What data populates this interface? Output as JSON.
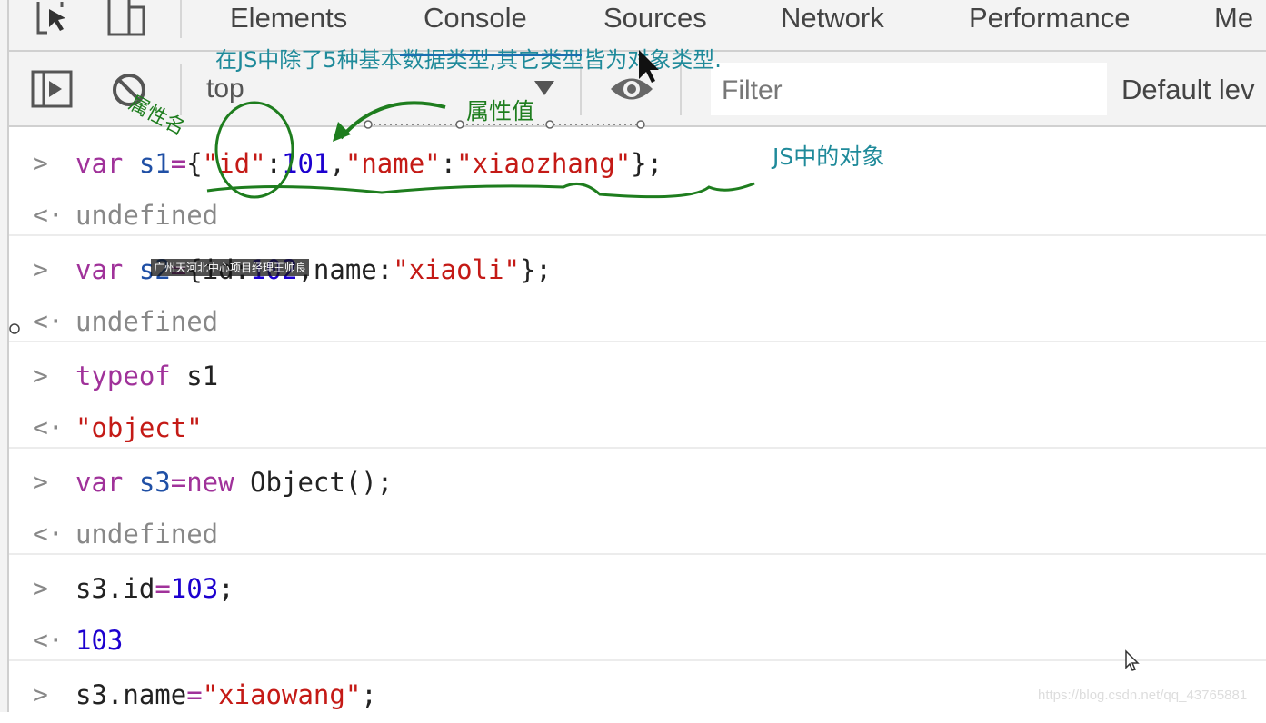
{
  "tabs": [
    "Elements",
    "Console",
    "Sources",
    "Network",
    "Performance",
    "Me"
  ],
  "toolbar": {
    "context": "top",
    "filter_placeholder": "Filter",
    "levels": "Default lev"
  },
  "console": [
    {
      "type": "input",
      "parts": [
        [
          "kw",
          "var "
        ],
        [
          "vr",
          "s1"
        ],
        [
          "kw",
          "="
        ],
        [
          "",
          "{"
        ],
        [
          "st",
          "\"id\""
        ],
        [
          "",
          ":"
        ],
        [
          "nm",
          "101"
        ],
        [
          "",
          ","
        ],
        [
          "st",
          "\"name\""
        ],
        [
          "",
          ":"
        ],
        [
          "st",
          "\"xiaozhang\""
        ],
        [
          "",
          "};"
        ]
      ]
    },
    {
      "type": "output",
      "parts": [
        [
          "gr",
          "undefined"
        ]
      ]
    },
    {
      "type": "input",
      "parts": [
        [
          "kw",
          "var "
        ],
        [
          "vr",
          "s2"
        ],
        [
          "kw",
          "="
        ],
        [
          "",
          "{id:"
        ],
        [
          "nm",
          "102"
        ],
        [
          "",
          ",name:"
        ],
        [
          "st",
          "\"xiaoli\""
        ],
        [
          "",
          "};"
        ]
      ]
    },
    {
      "type": "output",
      "parts": [
        [
          "gr",
          "undefined"
        ]
      ]
    },
    {
      "type": "input",
      "parts": [
        [
          "kw",
          "typeof "
        ],
        [
          "",
          "s1"
        ]
      ]
    },
    {
      "type": "output",
      "parts": [
        [
          "st",
          "\"object\""
        ]
      ]
    },
    {
      "type": "input",
      "parts": [
        [
          "kw",
          "var "
        ],
        [
          "vr",
          "s3"
        ],
        [
          "kw",
          "=new "
        ],
        [
          "",
          "Object();"
        ]
      ]
    },
    {
      "type": "output",
      "parts": [
        [
          "gr",
          "undefined"
        ]
      ]
    },
    {
      "type": "input",
      "parts": [
        [
          "",
          "s3.id"
        ],
        [
          "kw",
          "="
        ],
        [
          "nm",
          "103"
        ],
        [
          "",
          ";"
        ]
      ]
    },
    {
      "type": "output",
      "parts": [
        [
          "nm",
          "103"
        ]
      ]
    },
    {
      "type": "input",
      "parts": [
        [
          "",
          "s3.name"
        ],
        [
          "kw",
          "="
        ],
        [
          "st",
          "\"xiaowang\""
        ],
        [
          "",
          ";"
        ]
      ]
    }
  ],
  "annotations": {
    "top_note": "在JS中除了5种基本数据类型,其它类型皆为对象类型.",
    "prop_name": "属性名",
    "prop_value": "属性值",
    "js_object": "JS中的对象",
    "overlay_caption": "广州天河北中心项目经理王帅良"
  },
  "watermark": "https://blog.csdn.net/qq_43765881",
  "colors": {
    "annotation_green": "#1e7d1e",
    "annotation_teal": "#1f8a9a"
  }
}
